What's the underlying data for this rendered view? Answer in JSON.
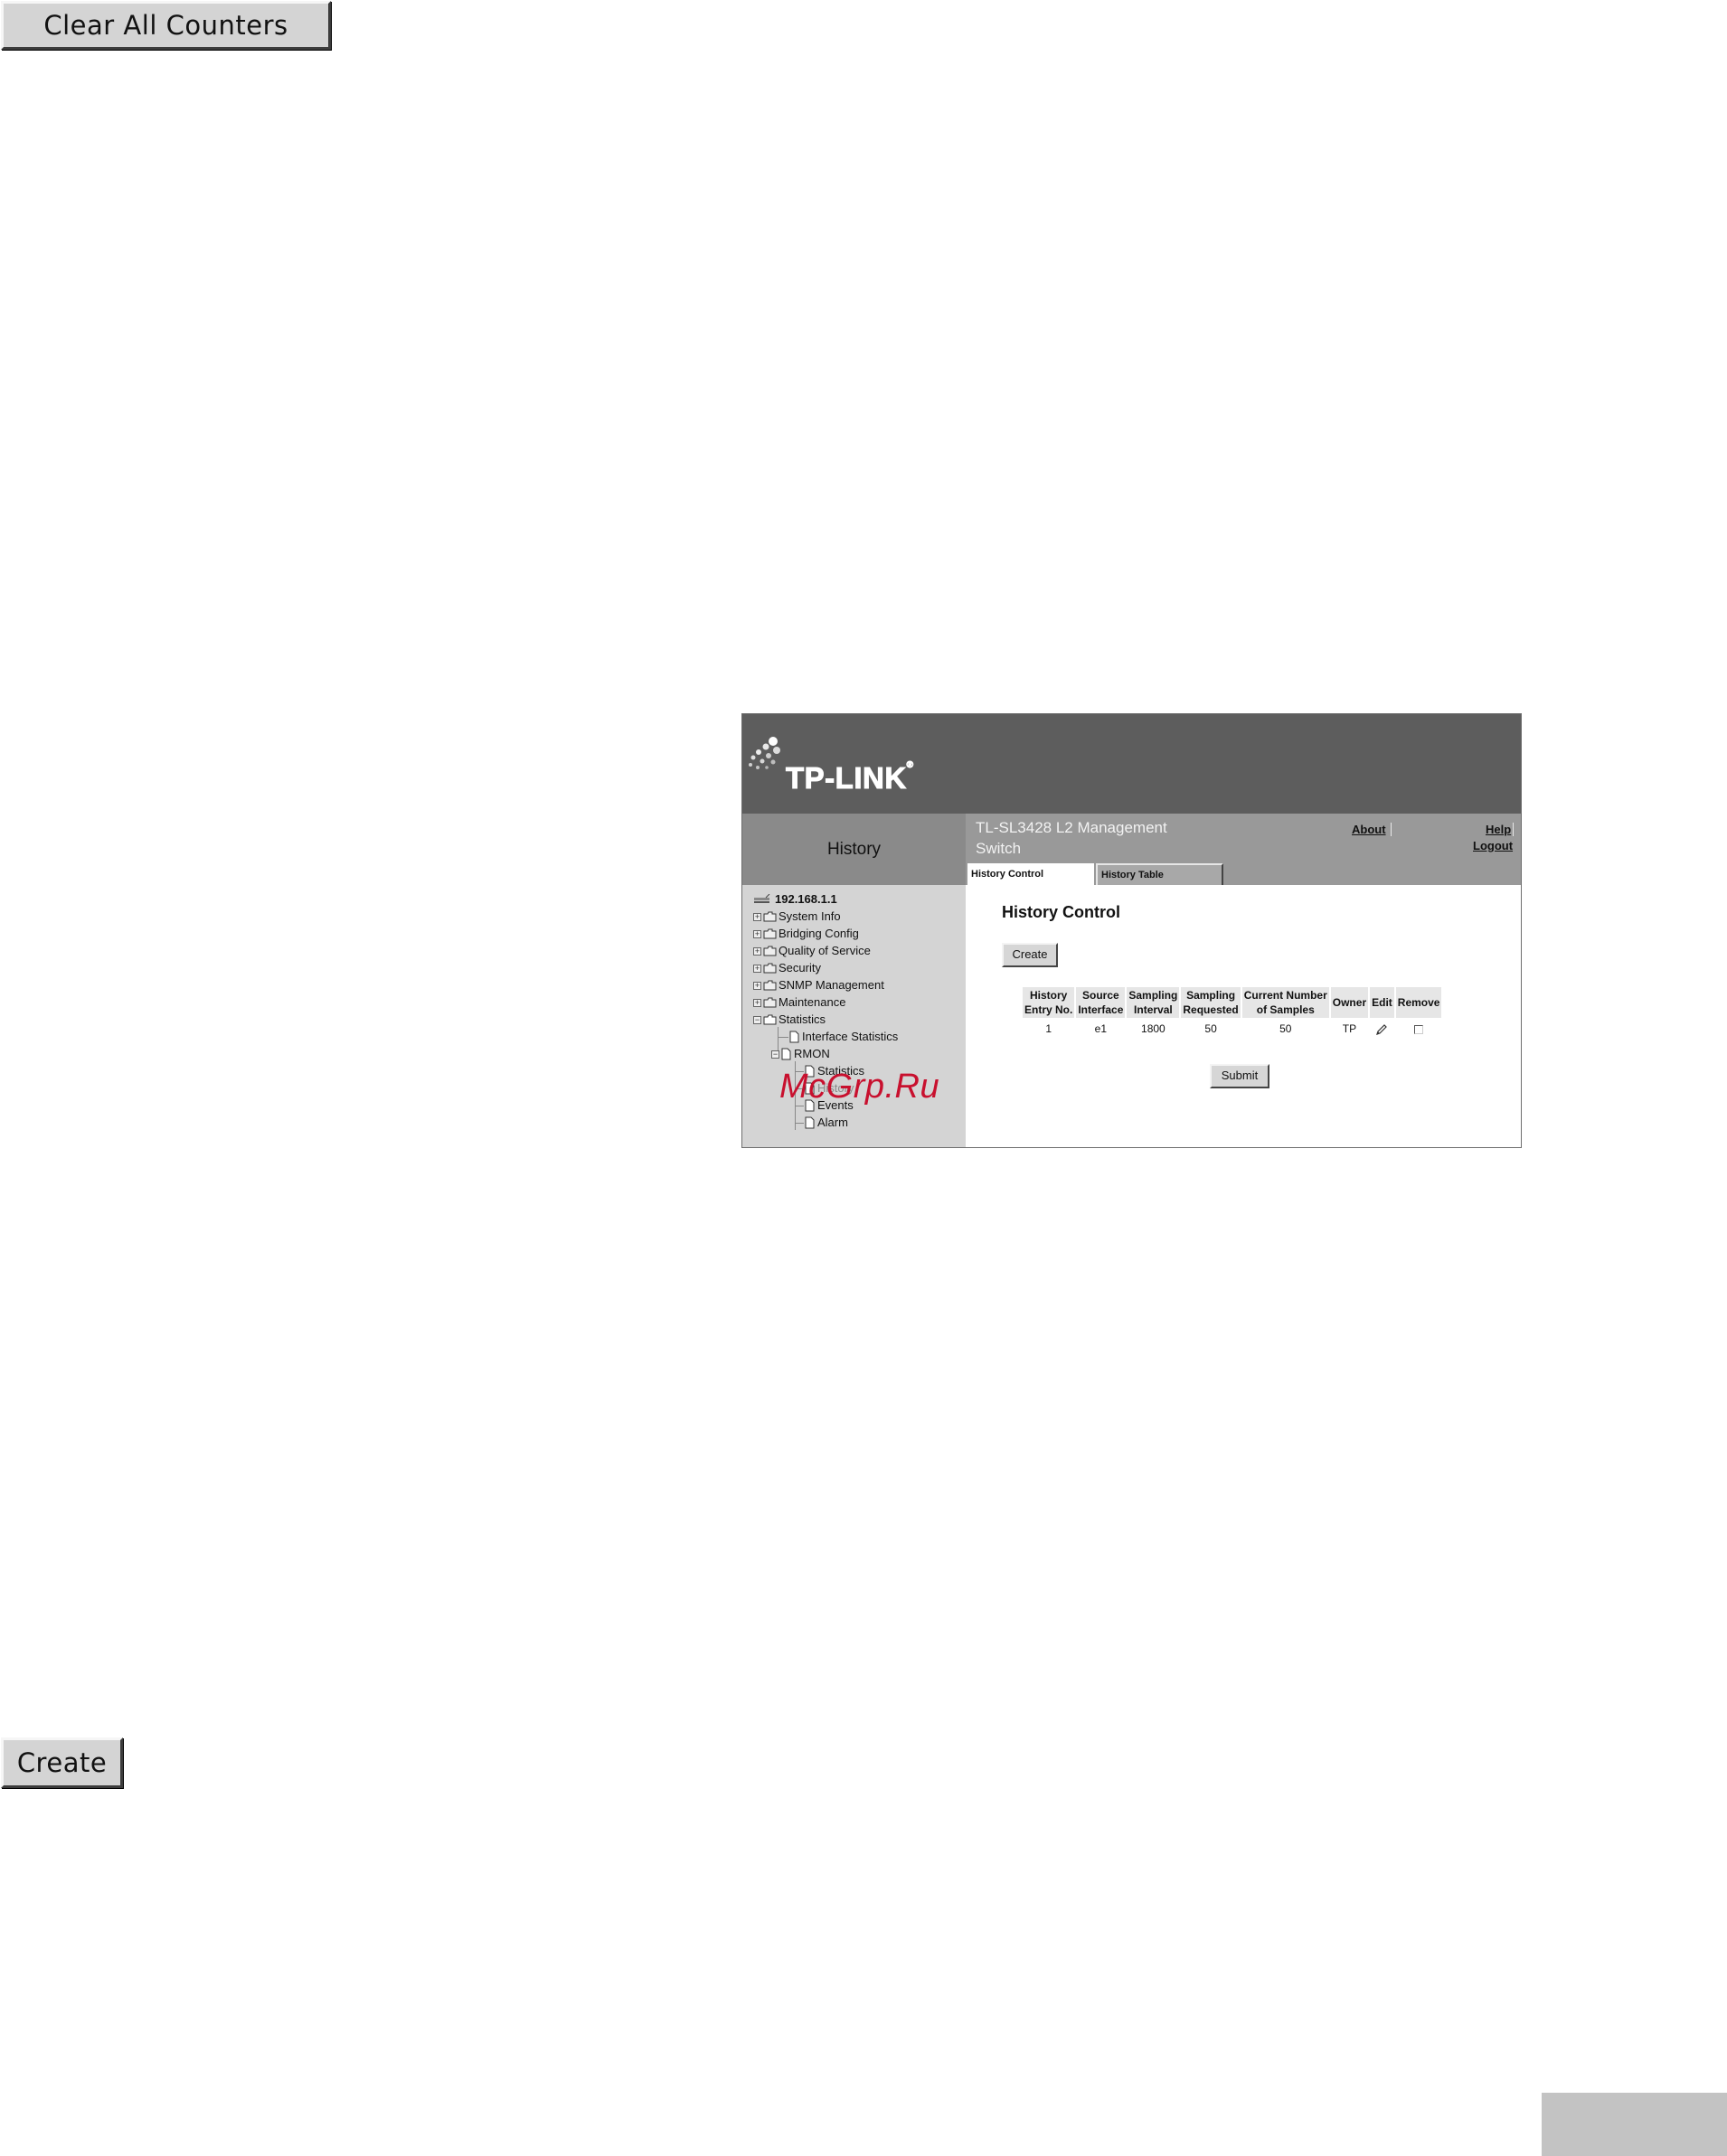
{
  "page": {
    "clear_button": "Clear All Counters",
    "create_button": "Create"
  },
  "screenshot": {
    "logo": "TP-LINK",
    "logo_mark": "®",
    "page_title": "History",
    "product": "TL-SL3428 L2 Management Switch",
    "links": {
      "about": "About",
      "help": "Help",
      "logout": "Logout"
    },
    "tabs": [
      {
        "label": "History Control",
        "active": true
      },
      {
        "label": "History Table",
        "active": false
      }
    ],
    "tree": {
      "root": "192.168.1.1",
      "items": [
        "System Info",
        "Bridging Config",
        "Quality of Service",
        "Security",
        "SNMP Management",
        "Maintenance",
        "Statistics",
        "Interface Statistics",
        "RMON",
        "Statistics",
        "History",
        "Events",
        "Alarm"
      ]
    },
    "content": {
      "title": "History Control",
      "create_button": "Create",
      "submit_button": "Submit",
      "table": {
        "headers": [
          [
            "History",
            "Entry No."
          ],
          [
            "Source",
            "Interface"
          ],
          [
            "Sampling",
            "Interval"
          ],
          [
            "Sampling",
            "Requested"
          ],
          [
            "Current Number",
            "of Samples"
          ],
          [
            "Owner",
            ""
          ],
          [
            "Edit",
            ""
          ],
          [
            "Remove",
            ""
          ]
        ],
        "rows": [
          [
            "1",
            "e1",
            "1800",
            "50",
            "50",
            "TP",
            "edit-icon",
            "unchecked"
          ]
        ]
      }
    },
    "watermark": "McGrp.Ru"
  },
  "colors": {
    "banner": "#5d5d5d",
    "sidebar": "#d4d4d4",
    "watermark": "#c8102e"
  }
}
